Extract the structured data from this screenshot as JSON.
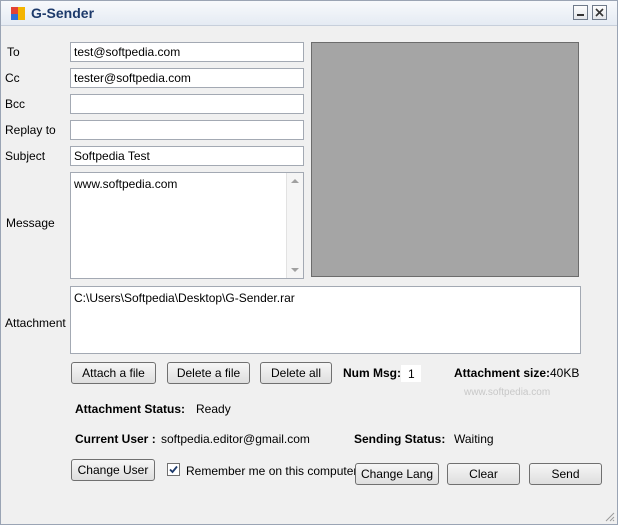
{
  "window": {
    "title": "G-Sender"
  },
  "form": {
    "to_label": "To",
    "to_value": "test@softpedia.com",
    "cc_label": "Cc",
    "cc_value": "tester@softpedia.com",
    "bcc_label": "Bcc",
    "bcc_value": "",
    "reply_label": "Replay to",
    "reply_value": "",
    "subject_label": "Subject",
    "subject_value": "Softpedia Test",
    "message_label": "Message",
    "message_value": "www.softpedia.com",
    "attachment_label": "Attachment",
    "attachment_value": "C:\\Users\\Softpedia\\Desktop\\G-Sender.rar"
  },
  "buttons": {
    "attach": "Attach a file",
    "delete": "Delete a file",
    "delete_all": "Delete all",
    "change_user": "Change User",
    "change_lang": "Change Lang",
    "clear": "Clear",
    "send": "Send"
  },
  "status": {
    "num_msg_label": "Num Msg:",
    "num_msg_value": "1",
    "attachment_size_label": "Attachment size:",
    "attachment_size_value": "40KB",
    "attachment_status_label": "Attachment Status:",
    "attachment_status_value": "Ready",
    "current_user_label": "Current User :",
    "current_user_value": "softpedia.editor@gmail.com",
    "sending_status_label": "Sending Status:",
    "sending_status_value": "Waiting"
  },
  "remember": {
    "label": "Remember me on this computer.",
    "checked": true
  },
  "watermark": "www.softpedia.com",
  "colors": {
    "preview_bg": "#a5a5a5",
    "title_text": "#1d3a6b"
  }
}
